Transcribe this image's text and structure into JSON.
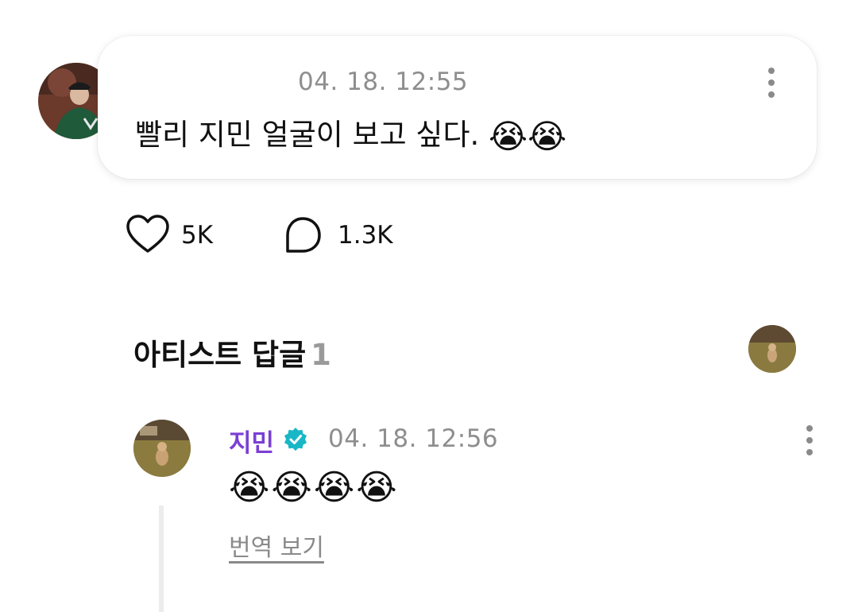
{
  "post": {
    "timestamp": "04. 18. 12:55",
    "text": "빨리 지민 얼굴이 보고 싶다.",
    "emoji": "😭😭",
    "likes": "5K",
    "comments": "1.3K"
  },
  "artist_replies": {
    "title": "아티스트 답글",
    "count": "1"
  },
  "reply": {
    "author": "지민",
    "timestamp": "04. 18. 12:56",
    "text": "😭😭😭😭",
    "translate_label": "번역 보기"
  },
  "icons": {
    "like": "heart-outline-icon",
    "comment": "speech-bubble-icon",
    "verified": "verified-badge-icon",
    "more": "more-vertical-icon"
  },
  "colors": {
    "artist_name": "#7b3fd3",
    "verified_badge": "#19b7c6",
    "meta_gray": "#8e8e8e"
  }
}
